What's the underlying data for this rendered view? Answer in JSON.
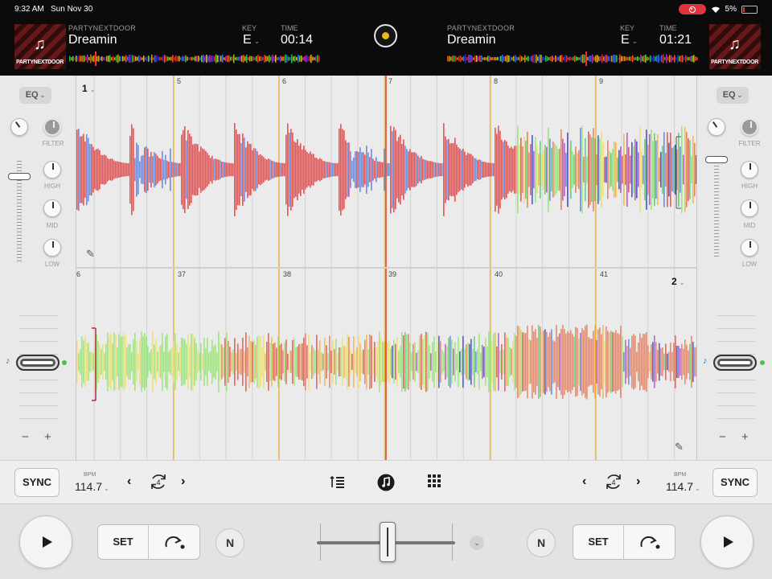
{
  "status": {
    "time": "9:32 AM",
    "date": "Sun Nov 30",
    "battery": "5%"
  },
  "decks": [
    {
      "artist": "PARTYNEXTDOOR",
      "title": "Dreamin",
      "key_label": "KEY",
      "key": "E",
      "time_label": "TIME",
      "time": "00:14",
      "number": "1",
      "bpm_label": "BPM",
      "bpm": "114.7",
      "loop_beats": "4",
      "art_brand": "PARTYNEXTDOOR"
    },
    {
      "artist": "PARTYNEXTDOOR",
      "title": "Dreamin",
      "key_label": "KEY",
      "key": "E",
      "time_label": "TIME",
      "time": "01:21",
      "number": "2",
      "bpm_label": "BPM",
      "bpm": "114.7",
      "loop_beats": "4",
      "art_brand": "PARTYNEXTDOOR"
    }
  ],
  "mixer": {
    "eq_label": "EQ",
    "filter_label": "FILTER",
    "high_label": "HIGH",
    "mid_label": "MID",
    "low_label": "LOW",
    "minus": "−",
    "plus": "+"
  },
  "beats": {
    "deck1": [
      "5",
      "6",
      "7",
      "8",
      "9"
    ],
    "deck2": [
      "6",
      "37",
      "38",
      "39",
      "40",
      "41"
    ]
  },
  "transport": {
    "sync_label": "SYNC",
    "set_label": "SET",
    "n_label": "N"
  },
  "colors": {
    "accent": "#f1b419",
    "playhead": "#e8452c",
    "beat_marker": "#f0a500",
    "record": "#e0343c"
  }
}
